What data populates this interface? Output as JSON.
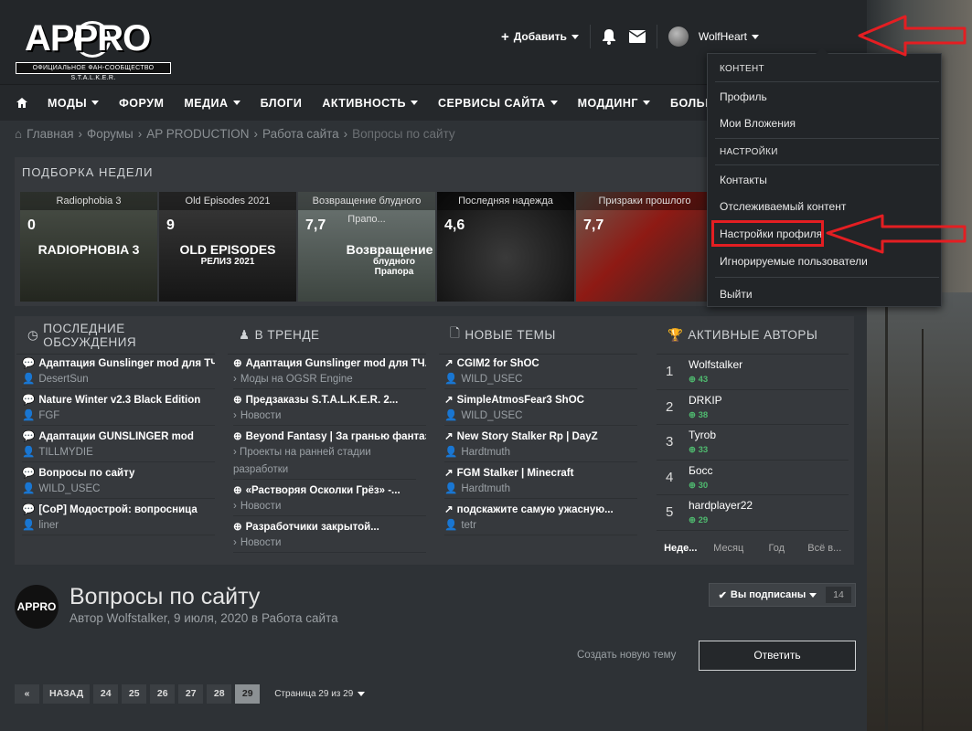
{
  "header": {
    "logo_big": "APPRO",
    "logo_small": "ОФИЦИАЛЬНОЕ ФАН-СООБЩЕСТВО S.T.A.L.K.E.R.",
    "add_label": "Добавить",
    "username": "WolfHeart"
  },
  "nav": {
    "items": [
      {
        "label": "МОДЫ",
        "dropdown": true
      },
      {
        "label": "ФОРУМ",
        "dropdown": false
      },
      {
        "label": "МЕДИА",
        "dropdown": true
      },
      {
        "label": "БЛОГИ",
        "dropdown": false
      },
      {
        "label": "АКТИВНОСТЬ",
        "dropdown": true
      },
      {
        "label": "СЕРВИСЫ САЙТА",
        "dropdown": true
      },
      {
        "label": "МОДДИНГ",
        "dropdown": true
      },
      {
        "label": "БОЛЬШЕ",
        "dropdown": true
      }
    ]
  },
  "breadcrumbs": [
    "Главная",
    "Форумы",
    "AP PRODUCTION",
    "Работа сайта",
    "Вопросы по сайту"
  ],
  "featured": {
    "title": "ПОДБОРКА НЕДЕЛИ",
    "cards": [
      {
        "caption": "Radiophobia 3",
        "score": "0",
        "art": "RADIOPHOBIA 3",
        "art2": ""
      },
      {
        "caption": "Old Episodes 2021",
        "score": "9",
        "art": "OLD EPISODES",
        "art2": "РЕЛИЗ 2021"
      },
      {
        "caption": "Возвращение блудного Прапо...",
        "score": "7,7",
        "art": "Возвращение",
        "art2": "блудного Прапора"
      },
      {
        "caption": "Последняя надежда",
        "score": "4,6",
        "art": "",
        "art2": ""
      },
      {
        "caption": "Призраки прошлого",
        "score": "7,7",
        "art": "",
        "art2": ""
      }
    ]
  },
  "discussions": {
    "title": "ПОСЛЕДНИЕ ОБСУЖДЕНИЯ",
    "items": [
      {
        "title": "Адаптация Gunslinger mod для ТЧ...",
        "sub": "DesertSun"
      },
      {
        "title": "Nature Winter v2.3 Black Edition",
        "sub": "FGF"
      },
      {
        "title": "Адаптации GUNSLINGER mod",
        "sub": "TILLMYDIE"
      },
      {
        "title": "Вопросы по сайту",
        "sub": "WILD_USEC"
      },
      {
        "title": "[CoP] Модострой: вопросница",
        "sub": "liner"
      }
    ]
  },
  "trending": {
    "title": "В ТРЕНДЕ",
    "items": [
      {
        "title": "Адаптация Gunslinger mod для ТЧ...",
        "sub": "Моды на OGSR Engine"
      },
      {
        "title": "Предзаказы S.T.A.L.K.E.R. 2...",
        "sub": "Новости"
      },
      {
        "title": "Beyond Fantasy | За гранью фантазии",
        "sub": "Проекты на ранней стадии разработки"
      },
      {
        "title": "«Растворяя Осколки Грёз» -...",
        "sub": "Новости"
      },
      {
        "title": "Разработчики закрытой...",
        "sub": "Новости"
      }
    ]
  },
  "newthreads": {
    "title": "НОВЫЕ ТЕМЫ",
    "items": [
      {
        "title": "CGIM2 for ShOC",
        "sub": "WILD_USEC"
      },
      {
        "title": "SimpleAtmosFear3 ShOC",
        "sub": "WILD_USEC"
      },
      {
        "title": "New Story Stalker Rp | DayZ",
        "sub": "Hardtmuth"
      },
      {
        "title": "FGM Stalker | Minecraft",
        "sub": "Hardtmuth"
      },
      {
        "title": "подскажите самую ужасную...",
        "sub": "tetr"
      }
    ]
  },
  "authors": {
    "title": "АКТИВНЫЕ АВТОРЫ",
    "items": [
      {
        "rank": "1",
        "name": "Wolfstalker",
        "points": "43"
      },
      {
        "rank": "2",
        "name": "DRKIP",
        "points": "38"
      },
      {
        "rank": "3",
        "name": "Tyrob",
        "points": "33"
      },
      {
        "rank": "4",
        "name": "Босс",
        "points": "30"
      },
      {
        "rank": "5",
        "name": "hardplayer22",
        "points": "29"
      }
    ],
    "tabs": [
      "Неде...",
      "Месяц",
      "Год",
      "Всё в..."
    ]
  },
  "thread": {
    "logo": "APPRO",
    "title": "Вопросы по сайту",
    "meta": "Автор Wolfstalker, 9 июля, 2020 в Работа сайта",
    "subscribed_label": "Вы подписаны",
    "subscribers": "14",
    "new_topic": "Создать новую тему",
    "reply": "Ответить"
  },
  "pagination": {
    "back": "НАЗАД",
    "pages": [
      "24",
      "25",
      "26",
      "27",
      "28",
      "29"
    ],
    "current": "29",
    "info": "Страница 29 из 29"
  },
  "menu": {
    "section1": "КОНТЕНТ",
    "profile": "Профиль",
    "attachments": "Мои Вложения",
    "section2": "НАСТРОЙКИ",
    "contacts": "Контакты",
    "followed": "Отслеживаемый контент",
    "profile_settings": "Настройки профиля",
    "ignored": "Игнорируемые пользователи",
    "logout": "Выйти"
  },
  "annotation_color": "#e41e22"
}
